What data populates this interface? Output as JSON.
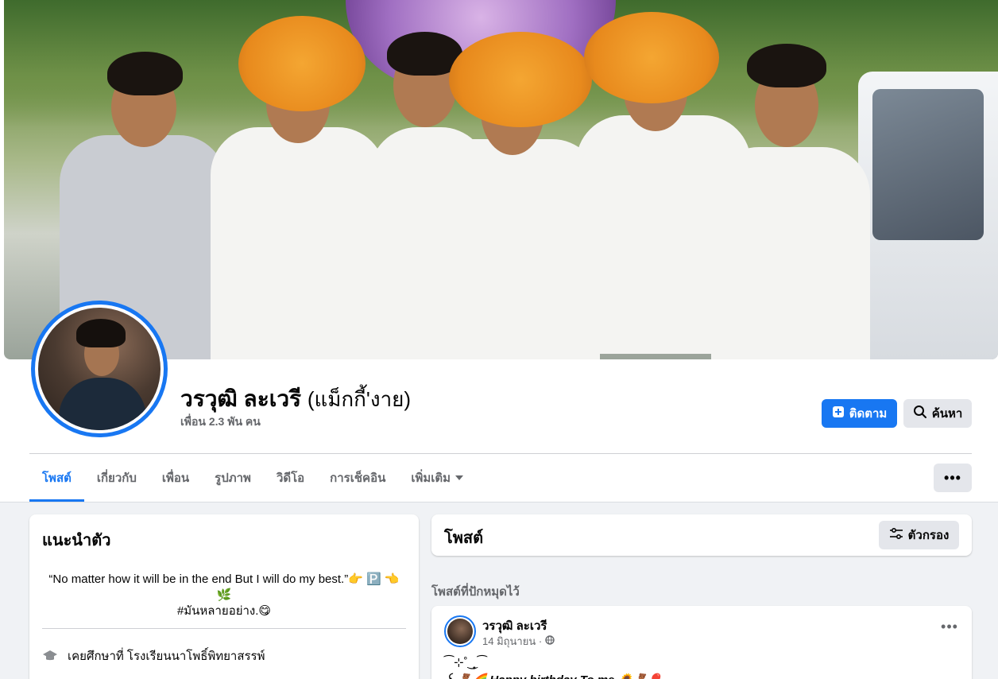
{
  "profile": {
    "name": "วรวุฒิ ละเวรี",
    "alt_name": "(แม็กกี้'งาย)",
    "friends": "เพื่อน 2.3 พัน คน"
  },
  "actions": {
    "follow_label": "ติดตาม",
    "search_label": "ค้นหา",
    "more_label": "•••"
  },
  "tabs": [
    {
      "label": "โพสต์"
    },
    {
      "label": "เกี่ยวกับ"
    },
    {
      "label": "เพื่อน"
    },
    {
      "label": "รูปภาพ"
    },
    {
      "label": "วิดีโอ"
    },
    {
      "label": "การเช็คอิน"
    },
    {
      "label": "เพิ่มเติม"
    }
  ],
  "intro": {
    "title": "แนะนำตัว",
    "bio_line1": "“No matter how it will be in the end But I will do my best.”👉 🅿️ 👈",
    "bio_line2": "🌿",
    "bio_line3": "#มันหลายอย่าง.😋",
    "education": "เคยศึกษาที่ โรงเรียนนาโพธิ์พิทยาสรรพ์"
  },
  "posts_section": {
    "title": "โพสต์",
    "filter_label": "ตัวกรอง",
    "pinned_label": "โพสต์ที่ปักหมุดไว้"
  },
  "post": {
    "author": "วรวุฒิ ละเวรี",
    "date": "14 มิถุนายน ·",
    "text1": "⁀⊹˚‿̩̥⁀",
    "text2": "꒰ 🧸🌈 Happy birthday To me 🌻🧸🎈"
  },
  "colors": {
    "accent": "#1877f2",
    "background": "#f0f2f5",
    "secondary_text": "#65676b"
  }
}
